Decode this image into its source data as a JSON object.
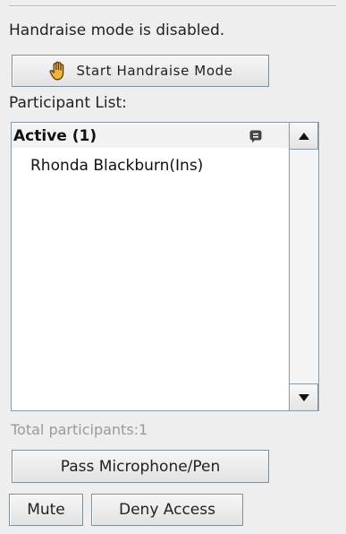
{
  "status": {
    "text": "Handraise mode is disabled."
  },
  "handraise_button": {
    "label": "Start Handraise Mode",
    "icon": "raised-hand-icon"
  },
  "participant_list": {
    "label": "Participant List:",
    "group": {
      "title": "Active (1)",
      "icon": "chat-icon"
    },
    "participants": [
      {
        "name": "Rhonda Blackburn(Ins)"
      }
    ],
    "total_text": "Total participants:1"
  },
  "actions": {
    "pass_label": "Pass Microphone/Pen",
    "mute_label": "Mute",
    "deny_label": "Deny Access"
  },
  "colors": {
    "panel_bg": "#eeeeee",
    "button_border": "#7f8d9c",
    "list_border": "#8c9aa8",
    "hand_icon": "#d4952a",
    "disabled_text": "#9a9a9a"
  }
}
